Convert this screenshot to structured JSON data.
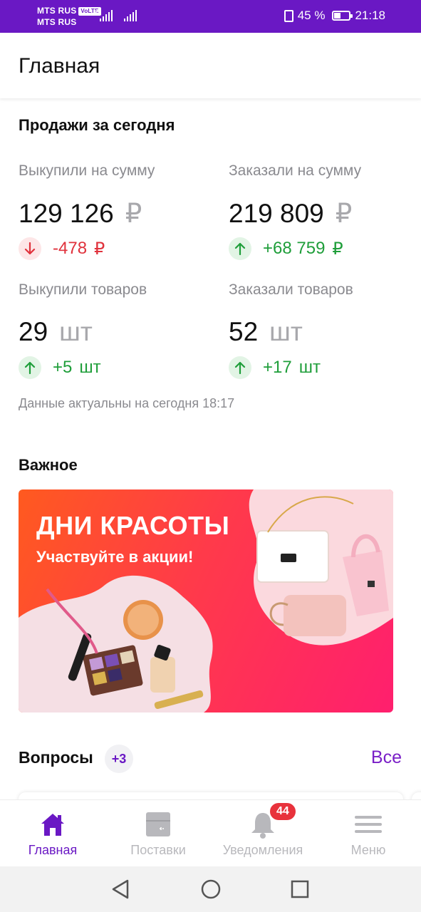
{
  "status_bar": {
    "carrier1": "MTS RUS",
    "carrier2": "MTS RUS",
    "volte": "VoLTE",
    "network": "4G",
    "battery_percent": "45 %",
    "battery_level": 0.45,
    "time": "21:18"
  },
  "header": {
    "title": "Главная"
  },
  "sales": {
    "title": "Продажи за сегодня",
    "metrics": [
      {
        "label": "Выкупили на сумму",
        "value": "129 126",
        "unit": "₽",
        "delta": "-478",
        "delta_unit": "₽",
        "direction": "down"
      },
      {
        "label": "Заказали на сумму",
        "value": "219 809",
        "unit": "₽",
        "delta": "+68 759",
        "delta_unit": "₽",
        "direction": "up"
      },
      {
        "label": "Выкупили товаров",
        "value": "29",
        "unit": "шт",
        "delta": "+5",
        "delta_unit": "шт",
        "direction": "up"
      },
      {
        "label": "Заказали товаров",
        "value": "52",
        "unit": "шт",
        "delta": "+17",
        "delta_unit": "шт",
        "direction": "up"
      }
    ],
    "updated": "Данные актуальны на сегодня 18:17"
  },
  "important": {
    "title": "Важное",
    "banner": {
      "title": "ДНИ КРАСОТЫ",
      "subtitle": "Участвуйте в акции!"
    }
  },
  "questions": {
    "title": "Вопросы",
    "badge": "+3",
    "all_link": "Все"
  },
  "bottom_nav": {
    "items": [
      {
        "label": "Главная",
        "icon": "home-icon",
        "active": true
      },
      {
        "label": "Поставки",
        "icon": "box-icon",
        "active": false
      },
      {
        "label": "Уведомления",
        "icon": "bell-icon",
        "active": false,
        "badge": "44"
      },
      {
        "label": "Меню",
        "icon": "menu-icon",
        "active": false
      }
    ]
  },
  "colors": {
    "brand": "#6a18c4",
    "negative": "#e0323c",
    "positive": "#1f9e3a"
  }
}
